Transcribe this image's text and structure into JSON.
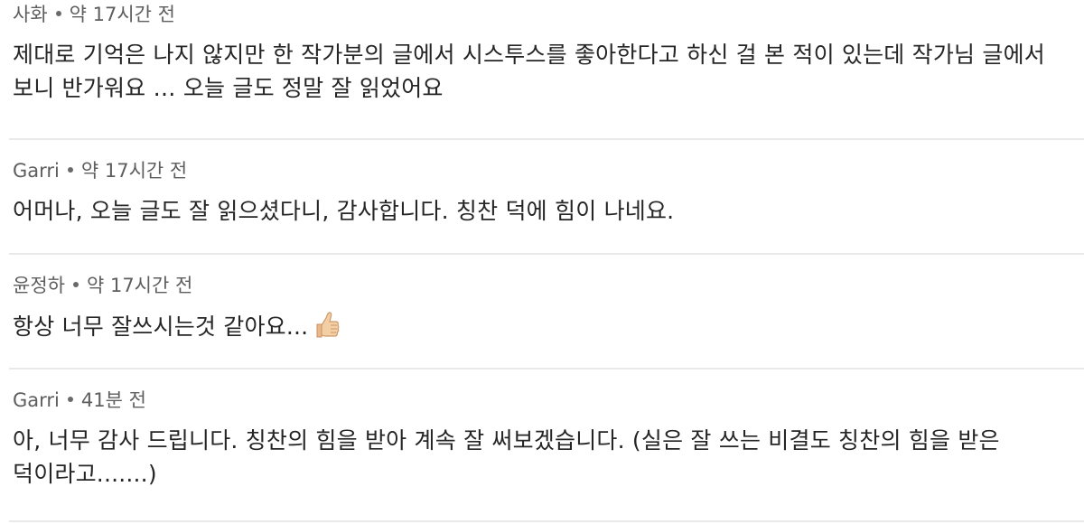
{
  "comments": [
    {
      "author": "사화",
      "time": "약 17시간 전",
      "text": "제대로 기억은 나지 않지만 한 작가분의 글에서 시스투스를 좋아한다고 하신 걸 본 적이 있는데 작가님 글에서 보니 반가워요 … 오늘 글도 정말 잘 읽었어요"
    },
    {
      "author": "Garri",
      "time": "약 17시간 전",
      "text": "어머나, 오늘 글도 잘 읽으셨다니, 감사합니다. 칭찬 덕에 힘이 나네요."
    },
    {
      "author": "윤정하",
      "time": "약 17시간 전",
      "text": "항상 너무 잘쓰시는것 같아요...",
      "emoji": "thumbs-up-icon"
    },
    {
      "author": "Garri",
      "time": "41분 전",
      "text": "아, 너무 감사 드립니다. 칭찬의 힘을 받아 계속 잘 써보겠습니다. (실은 잘 쓰는 비결도 칭찬의 힘을 받은 덕이라고.......)"
    }
  ],
  "colors": {
    "meta_text": "#5e5e5e",
    "body_text": "#252525",
    "divider": "#e9e9e9",
    "thumb_skin": "#f3cfa6"
  }
}
